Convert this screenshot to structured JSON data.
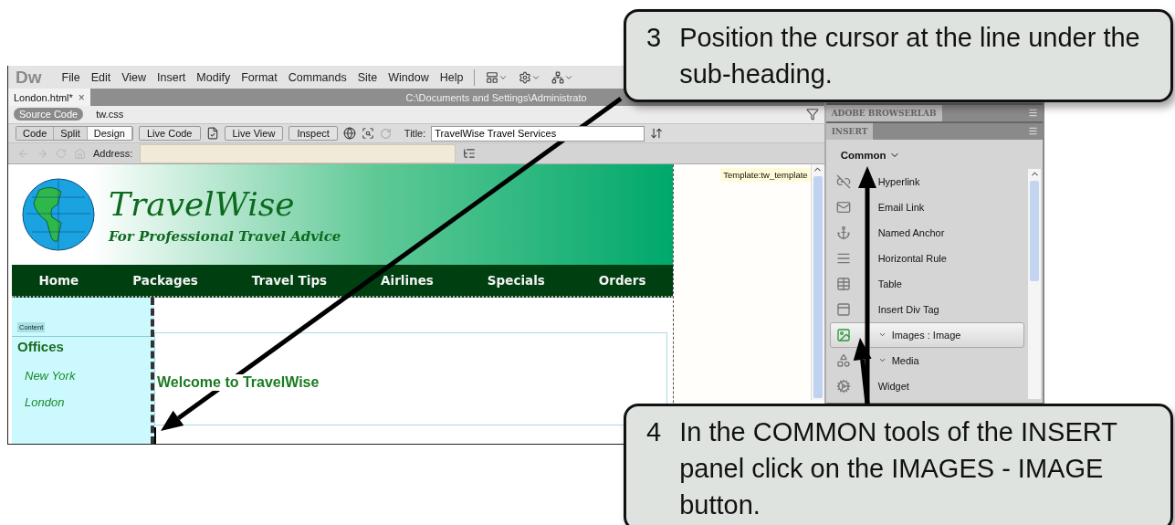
{
  "menu_bar": {
    "logo": "Dw",
    "items": [
      "File",
      "Edit",
      "View",
      "Insert",
      "Modify",
      "Format",
      "Commands",
      "Site",
      "Window",
      "Help"
    ]
  },
  "document_tab": {
    "label": "London.html*",
    "close": "×",
    "path": "C:\\Documents and Settings\\Administrato"
  },
  "related_files": [
    {
      "label": "Source Code",
      "selected": true
    },
    {
      "label": "tw.css",
      "selected": false
    }
  ],
  "view_buttons": [
    {
      "label": "Code",
      "selected": false
    },
    {
      "label": "Split",
      "selected": false
    },
    {
      "label": "Design",
      "selected": true
    }
  ],
  "live_buttons": [
    "Live Code",
    "Live View",
    "Inspect"
  ],
  "title_field": {
    "label": "Title:",
    "value": "TravelWise Travel Services"
  },
  "address_field": {
    "label": "Address:"
  },
  "site": {
    "brand": "TravelWise",
    "tagline": "For Professional Travel Advice",
    "nav": [
      "Home",
      "Packages",
      "Travel Tips",
      "Airlines",
      "Specials",
      "Orders"
    ],
    "content_tag": "Content",
    "sidebar_heading": "Offices",
    "sidebar_links": [
      "New York",
      "London"
    ],
    "heading": "Welcome to TravelWise",
    "template_tag": "Template:tw_template"
  },
  "panel": {
    "tabs": [
      "ADOBE BROWSERLAB",
      "INSERT"
    ],
    "category": "Common",
    "items": [
      {
        "label": "Hyperlink",
        "kind": "hyperlink",
        "dropdown": false,
        "selected": false
      },
      {
        "label": "Email Link",
        "kind": "email",
        "dropdown": false,
        "selected": false
      },
      {
        "label": "Named Anchor",
        "kind": "anchor",
        "dropdown": false,
        "selected": false
      },
      {
        "label": "Horizontal Rule",
        "kind": "rule",
        "dropdown": false,
        "selected": false
      },
      {
        "label": "Table",
        "kind": "table",
        "dropdown": false,
        "selected": false
      },
      {
        "label": "Insert Div Tag",
        "kind": "div",
        "dropdown": false,
        "selected": false
      },
      {
        "label": "Images : Image",
        "kind": "image",
        "dropdown": true,
        "selected": true
      },
      {
        "label": "Media",
        "kind": "media",
        "dropdown": true,
        "selected": false
      },
      {
        "label": "Widget",
        "kind": "widget",
        "dropdown": false,
        "selected": false
      }
    ]
  },
  "callouts": [
    {
      "number": "3",
      "text": "Position the cursor at the line under the sub-heading."
    },
    {
      "number": "4",
      "text": "In the COMMON tools of the INSERT panel click on the IMAGES - IMAGE button."
    }
  ]
}
